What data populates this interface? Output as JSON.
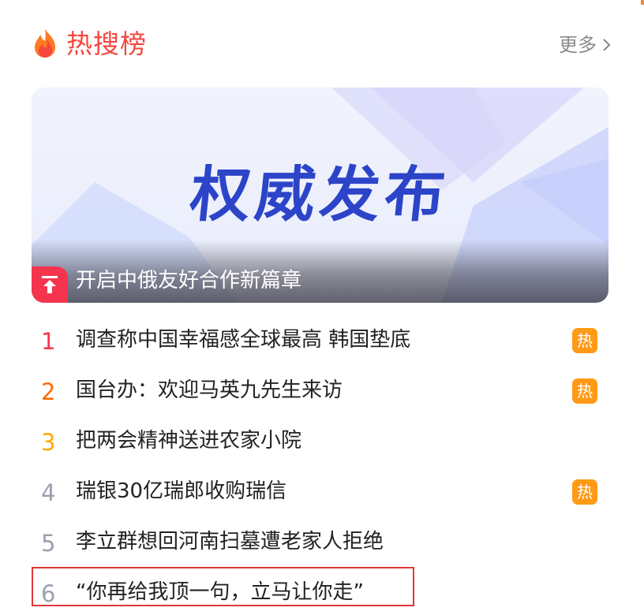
{
  "header": {
    "title": "热搜榜",
    "more_label": "更多"
  },
  "banner": {
    "headline": "权威发布",
    "caption": "开启中俄友好合作新篇章"
  },
  "list": [
    {
      "rank": "1",
      "text": "调查称中国幸福感全球最高 韩国垫底",
      "tag": "热",
      "rank_color": "#f5344e"
    },
    {
      "rank": "2",
      "text": "国台办：欢迎马英九先生来访",
      "tag": "热",
      "rank_color": "#ff6a00"
    },
    {
      "rank": "3",
      "text": "把两会精神送进农家小院",
      "tag": "",
      "rank_color": "#ffa800"
    },
    {
      "rank": "4",
      "text": "瑞银30亿瑞郎收购瑞信",
      "tag": "热",
      "rank_color": "#9aa0ad"
    },
    {
      "rank": "5",
      "text": "李立群想回河南扫墓遭老家人拒绝",
      "tag": "",
      "rank_color": "#9aa0ad"
    },
    {
      "rank": "6",
      "text": "“你再给我顶一句，立马让你走”",
      "tag": "",
      "rank_color": "#9aa0ad"
    }
  ],
  "colors": {
    "accent": "#f5473e",
    "hot_tag": "#ff9a16",
    "banner_headline": "#2c44c8",
    "highlight_border": "#e0363a"
  },
  "icons": {
    "logo": "flame-icon",
    "more": "chevron-right-icon",
    "pin": "pin-top-icon"
  }
}
